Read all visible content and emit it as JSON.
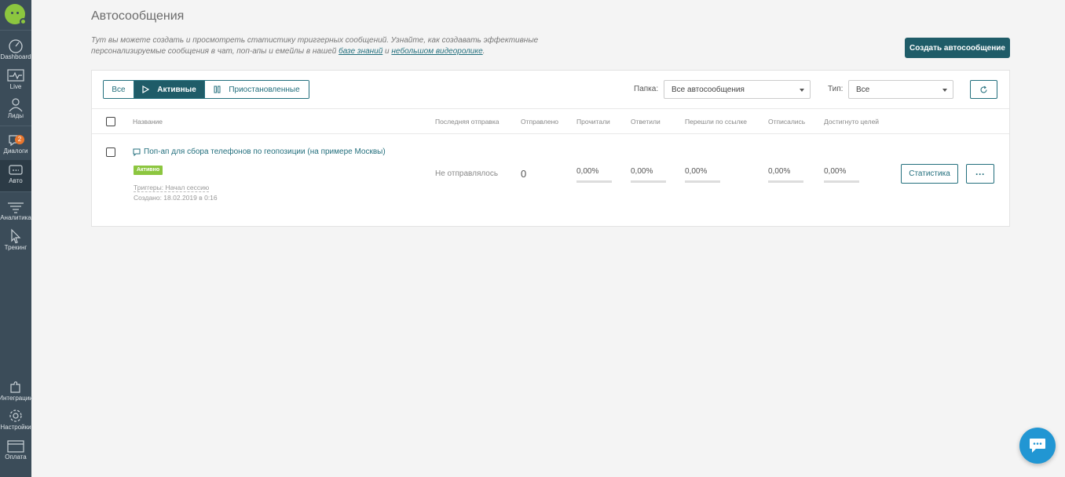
{
  "sidebar": {
    "items": [
      {
        "label": "Dashboard",
        "icon": "gauge-icon"
      },
      {
        "label": "Live",
        "icon": "pulse-icon"
      },
      {
        "label": "Лиды",
        "icon": "users-icon"
      },
      {
        "label": "Диалоги",
        "icon": "chat-icon",
        "badge": "2"
      },
      {
        "label": "Авто",
        "icon": "auto-message-icon"
      },
      {
        "label": "Аналитика",
        "icon": "funnel-icon"
      },
      {
        "label": "Трекинг",
        "icon": "cursor-icon"
      }
    ],
    "bottom_items": [
      {
        "label": "Интеграции",
        "icon": "puzzle-icon"
      },
      {
        "label": "Настройки",
        "icon": "gear-icon"
      },
      {
        "label": "Оплата",
        "icon": "card-icon"
      }
    ]
  },
  "header": {
    "title": "Автосообщения",
    "desc_part1": "Тут вы можете создать и просмотреть статистику триггерных сообщений. Узнайте, как создавать эффективные персонализируемые сообщения в чат, поп-апы и емейлы в нашей ",
    "desc_link1": "базе знаний",
    "desc_part2": " и ",
    "desc_link2": "небольшом видеоролике",
    "desc_part3": ".",
    "create_button": "Создать автосообщение"
  },
  "filters": {
    "tabs": [
      "Все",
      "Активные",
      "Приостановленные"
    ],
    "active_tab": "Активные",
    "folder_label": "Папка:",
    "folder_value": "Все автосообщения",
    "type_label": "Тип:",
    "type_value": "Все"
  },
  "table": {
    "columns": [
      "Название",
      "Последняя отправка",
      "Отправлено",
      "Прочитали",
      "Ответили",
      "Перешли по ссылке",
      "Отписались",
      "Достигнуто целей"
    ],
    "rows": [
      {
        "name": "Поп-ап для сбора телефонов по геопозиции (на примере Москвы)",
        "status": "Активно",
        "triggers": "Триггеры: Начал сессию",
        "created": "Создано: 18.02.2019 в 0:16",
        "last_sent": "Не отправлялось",
        "sent": "0",
        "read": "0,00%",
        "replied": "0,00%",
        "clicked": "0,00%",
        "unsubscribed": "0,00%",
        "goals": "0,00%",
        "stats_button": "Статистика",
        "more_button": "···"
      }
    ]
  },
  "colors": {
    "sidebar": "#3b4c59",
    "accent": "#1f5c68",
    "link": "#236f7d",
    "status_active": "#8cc63f",
    "badge": "#e8762d",
    "chat_widget": "#2196d3"
  }
}
